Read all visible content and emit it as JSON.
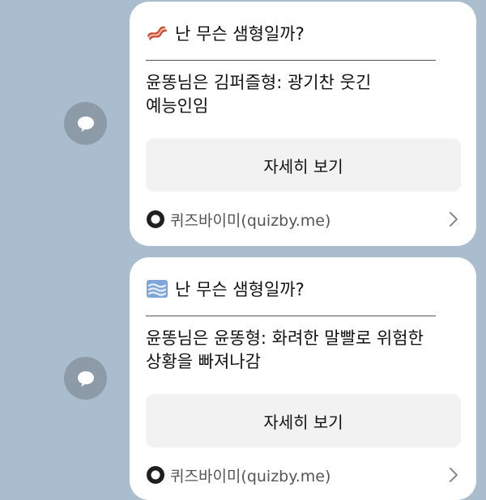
{
  "messages": [
    {
      "emoji_icon": "bacon-icon",
      "title": "난 무슨 샘형일까?",
      "result": "윤똥님은 김퍼즐형: 광기찬 웃긴\n예능인임",
      "cta_label": "자세히 보기",
      "brand": "퀴즈바이미(quizby.me)"
    },
    {
      "emoji_icon": "fog-icon",
      "title": "난 무슨 샘형일까?",
      "result": "윤똥님은 윤똥형: 화려한 말빨로 위험한\n상황을 빠져나감",
      "cta_label": "자세히 보기",
      "brand": "퀴즈바이미(quizby.me)"
    }
  ],
  "share_icon": "speech-bubble-icon",
  "colors": {
    "chat_background": "#a9bdce",
    "card_background": "#ffffff",
    "cta_background": "#f2f2f2",
    "share_button": "#8d9ba8"
  }
}
